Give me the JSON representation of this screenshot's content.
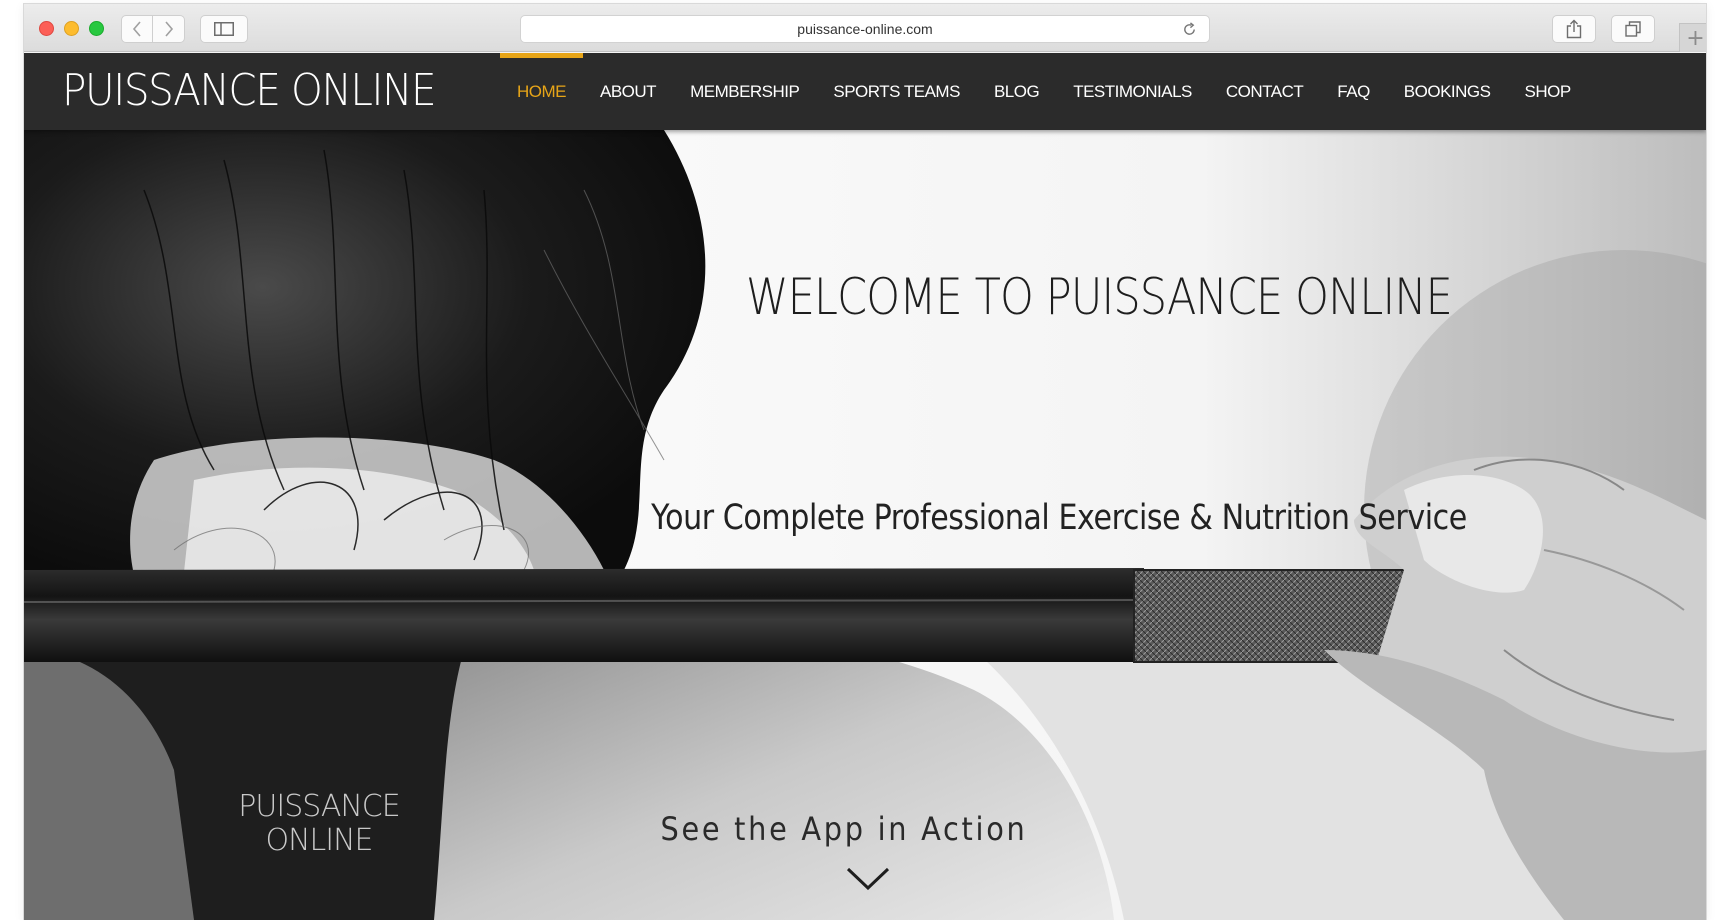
{
  "browser": {
    "url": "puissance-online.com",
    "new_tab_glyph": "+"
  },
  "site": {
    "logo": "PUISSANCE ONLINE",
    "nav": [
      {
        "label": "HOME",
        "active": true
      },
      {
        "label": "ABOUT"
      },
      {
        "label": "MEMBERSHIP"
      },
      {
        "label": "SPORTS TEAMS"
      },
      {
        "label": "BLOG"
      },
      {
        "label": "TESTIMONIALS"
      },
      {
        "label": "CONTACT"
      },
      {
        "label": "FAQ"
      },
      {
        "label": "BOOKINGS"
      },
      {
        "label": "SHOP"
      }
    ]
  },
  "hero": {
    "title": "WELCOME TO PUISSANCE ONLINE",
    "subtitle": "Your Complete Professional Exercise & Nutrition Service",
    "cta_label": "See the App in Action",
    "shirt_logo_line1": "PUISSANCE",
    "shirt_logo_line2": "ONLINE"
  },
  "colors": {
    "header_bg": "#2b2b2b",
    "accent": "#e7a518",
    "nav_text": "#ffffff"
  },
  "icons": [
    "back-chevron-icon",
    "forward-chevron-icon",
    "sidebar-icon",
    "reload-icon",
    "share-icon",
    "tabs-icon",
    "plus-icon",
    "chevron-down-icon"
  ]
}
